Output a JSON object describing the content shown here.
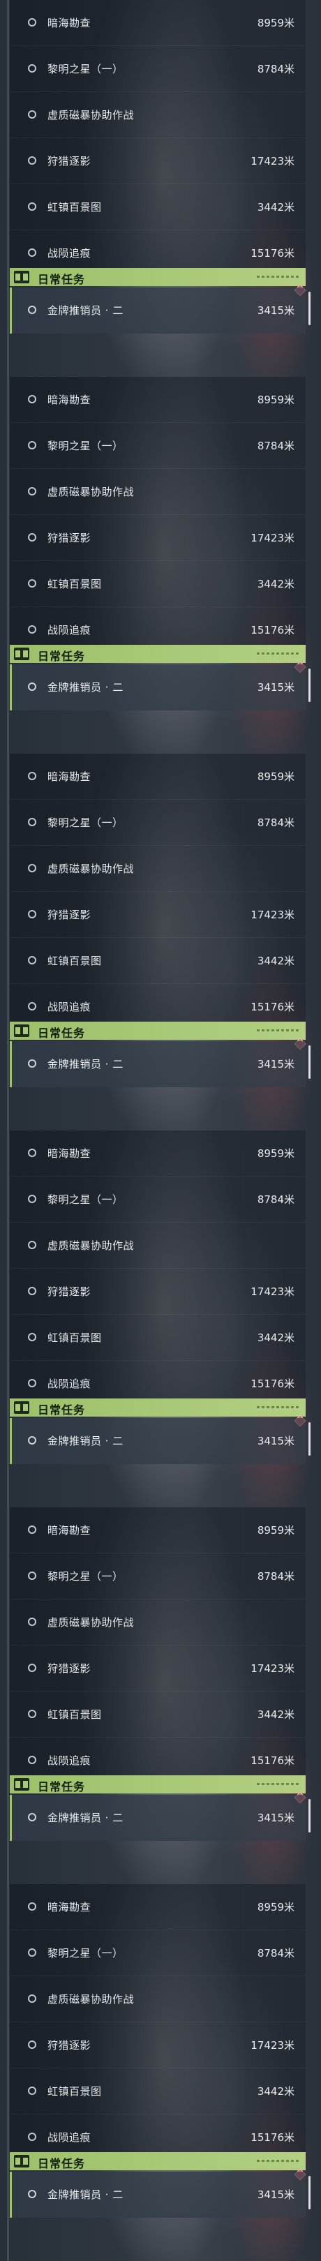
{
  "tasks": [
    {
      "name": "暗海勘查",
      "distance": "8959米"
    },
    {
      "name": "黎明之星（一）",
      "distance": "8784米"
    },
    {
      "name": "虚质磁暴协助作战",
      "distance": ""
    },
    {
      "name": "狩猎逐影",
      "distance": "17423米"
    },
    {
      "name": "虹镇百景图",
      "distance": "3442米"
    },
    {
      "name": "战陨追痕",
      "distance": "15176米"
    }
  ],
  "daily": {
    "title": "日常任务",
    "task_name": "金牌推销员 · 二",
    "task_distance": "3415米"
  },
  "colors": {
    "daily_header": "#a8c977",
    "alert_marker": "#d85a67"
  },
  "icons": {
    "bullet": "hollow-circle-icon",
    "daily": "book-icon",
    "marker": "diamond-icon"
  }
}
